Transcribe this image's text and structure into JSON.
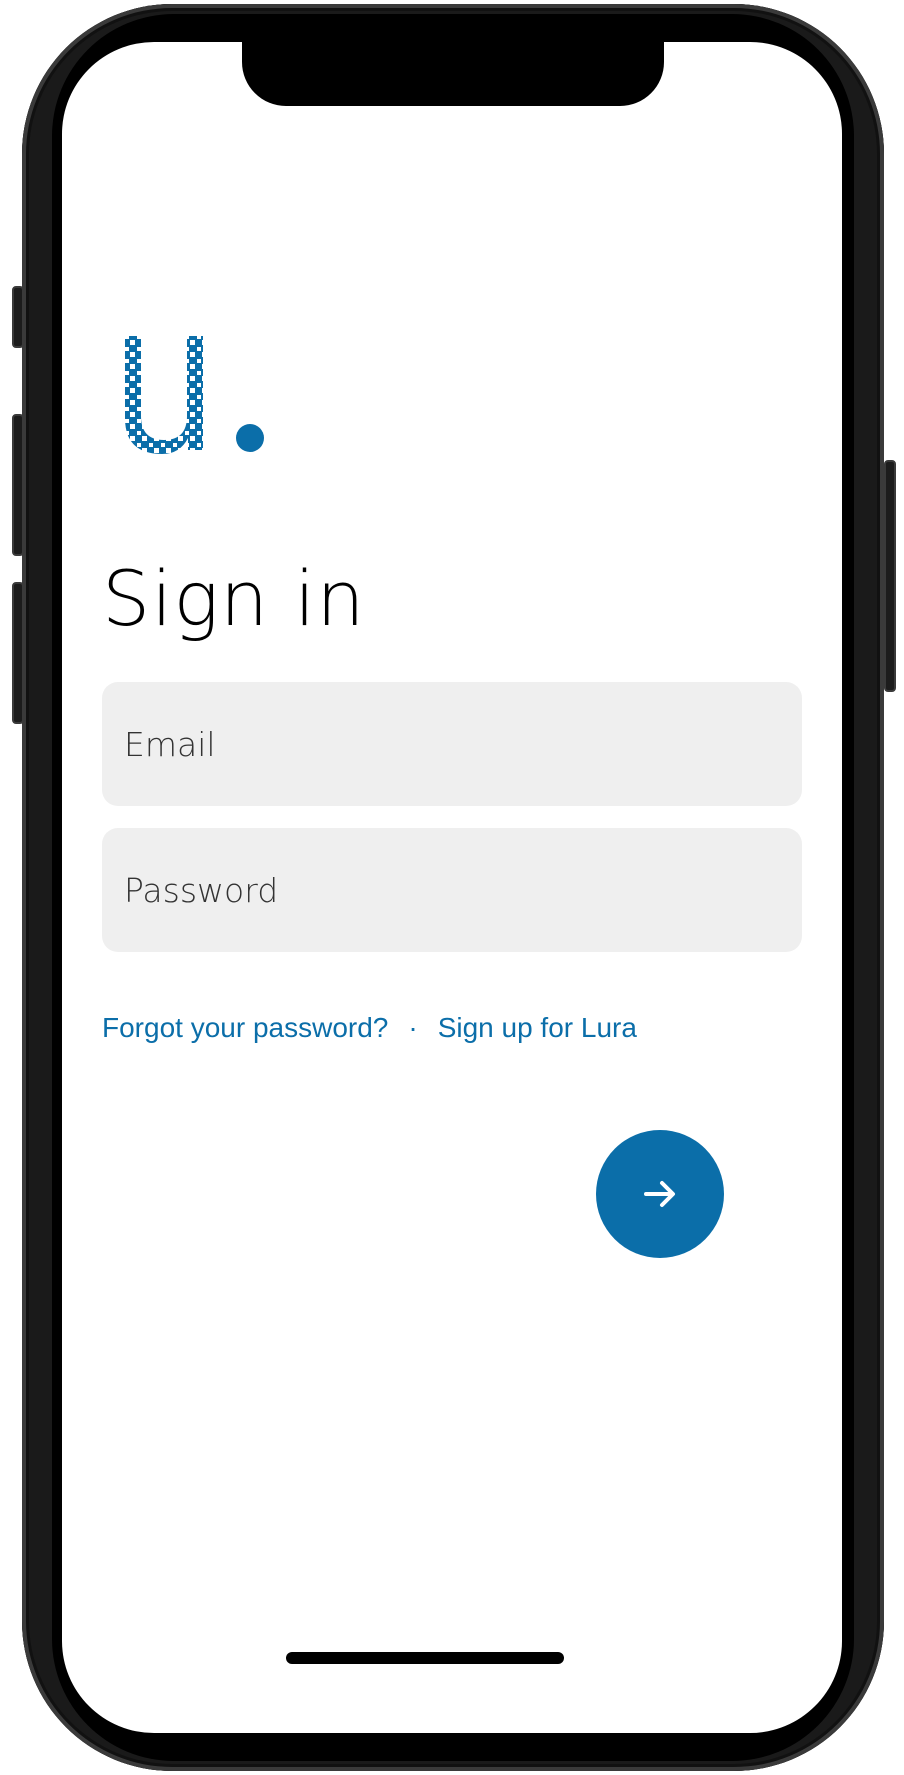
{
  "app": {
    "title": "Sign in"
  },
  "form": {
    "email": {
      "value": "",
      "placeholder": "Email"
    },
    "password": {
      "value": "",
      "placeholder": "Password"
    }
  },
  "links": {
    "forgot_password": "Forgot your password?",
    "separator": "·",
    "sign_up": "Sign up for Lura"
  },
  "next_button": {
    "icon": "arrow-right-icon"
  },
  "logo": {
    "icon": "brand-logo-icon",
    "text": "U."
  },
  "colors": {
    "accent": "#0b6ea9",
    "field_background": "#efefef",
    "text": "#000000"
  }
}
